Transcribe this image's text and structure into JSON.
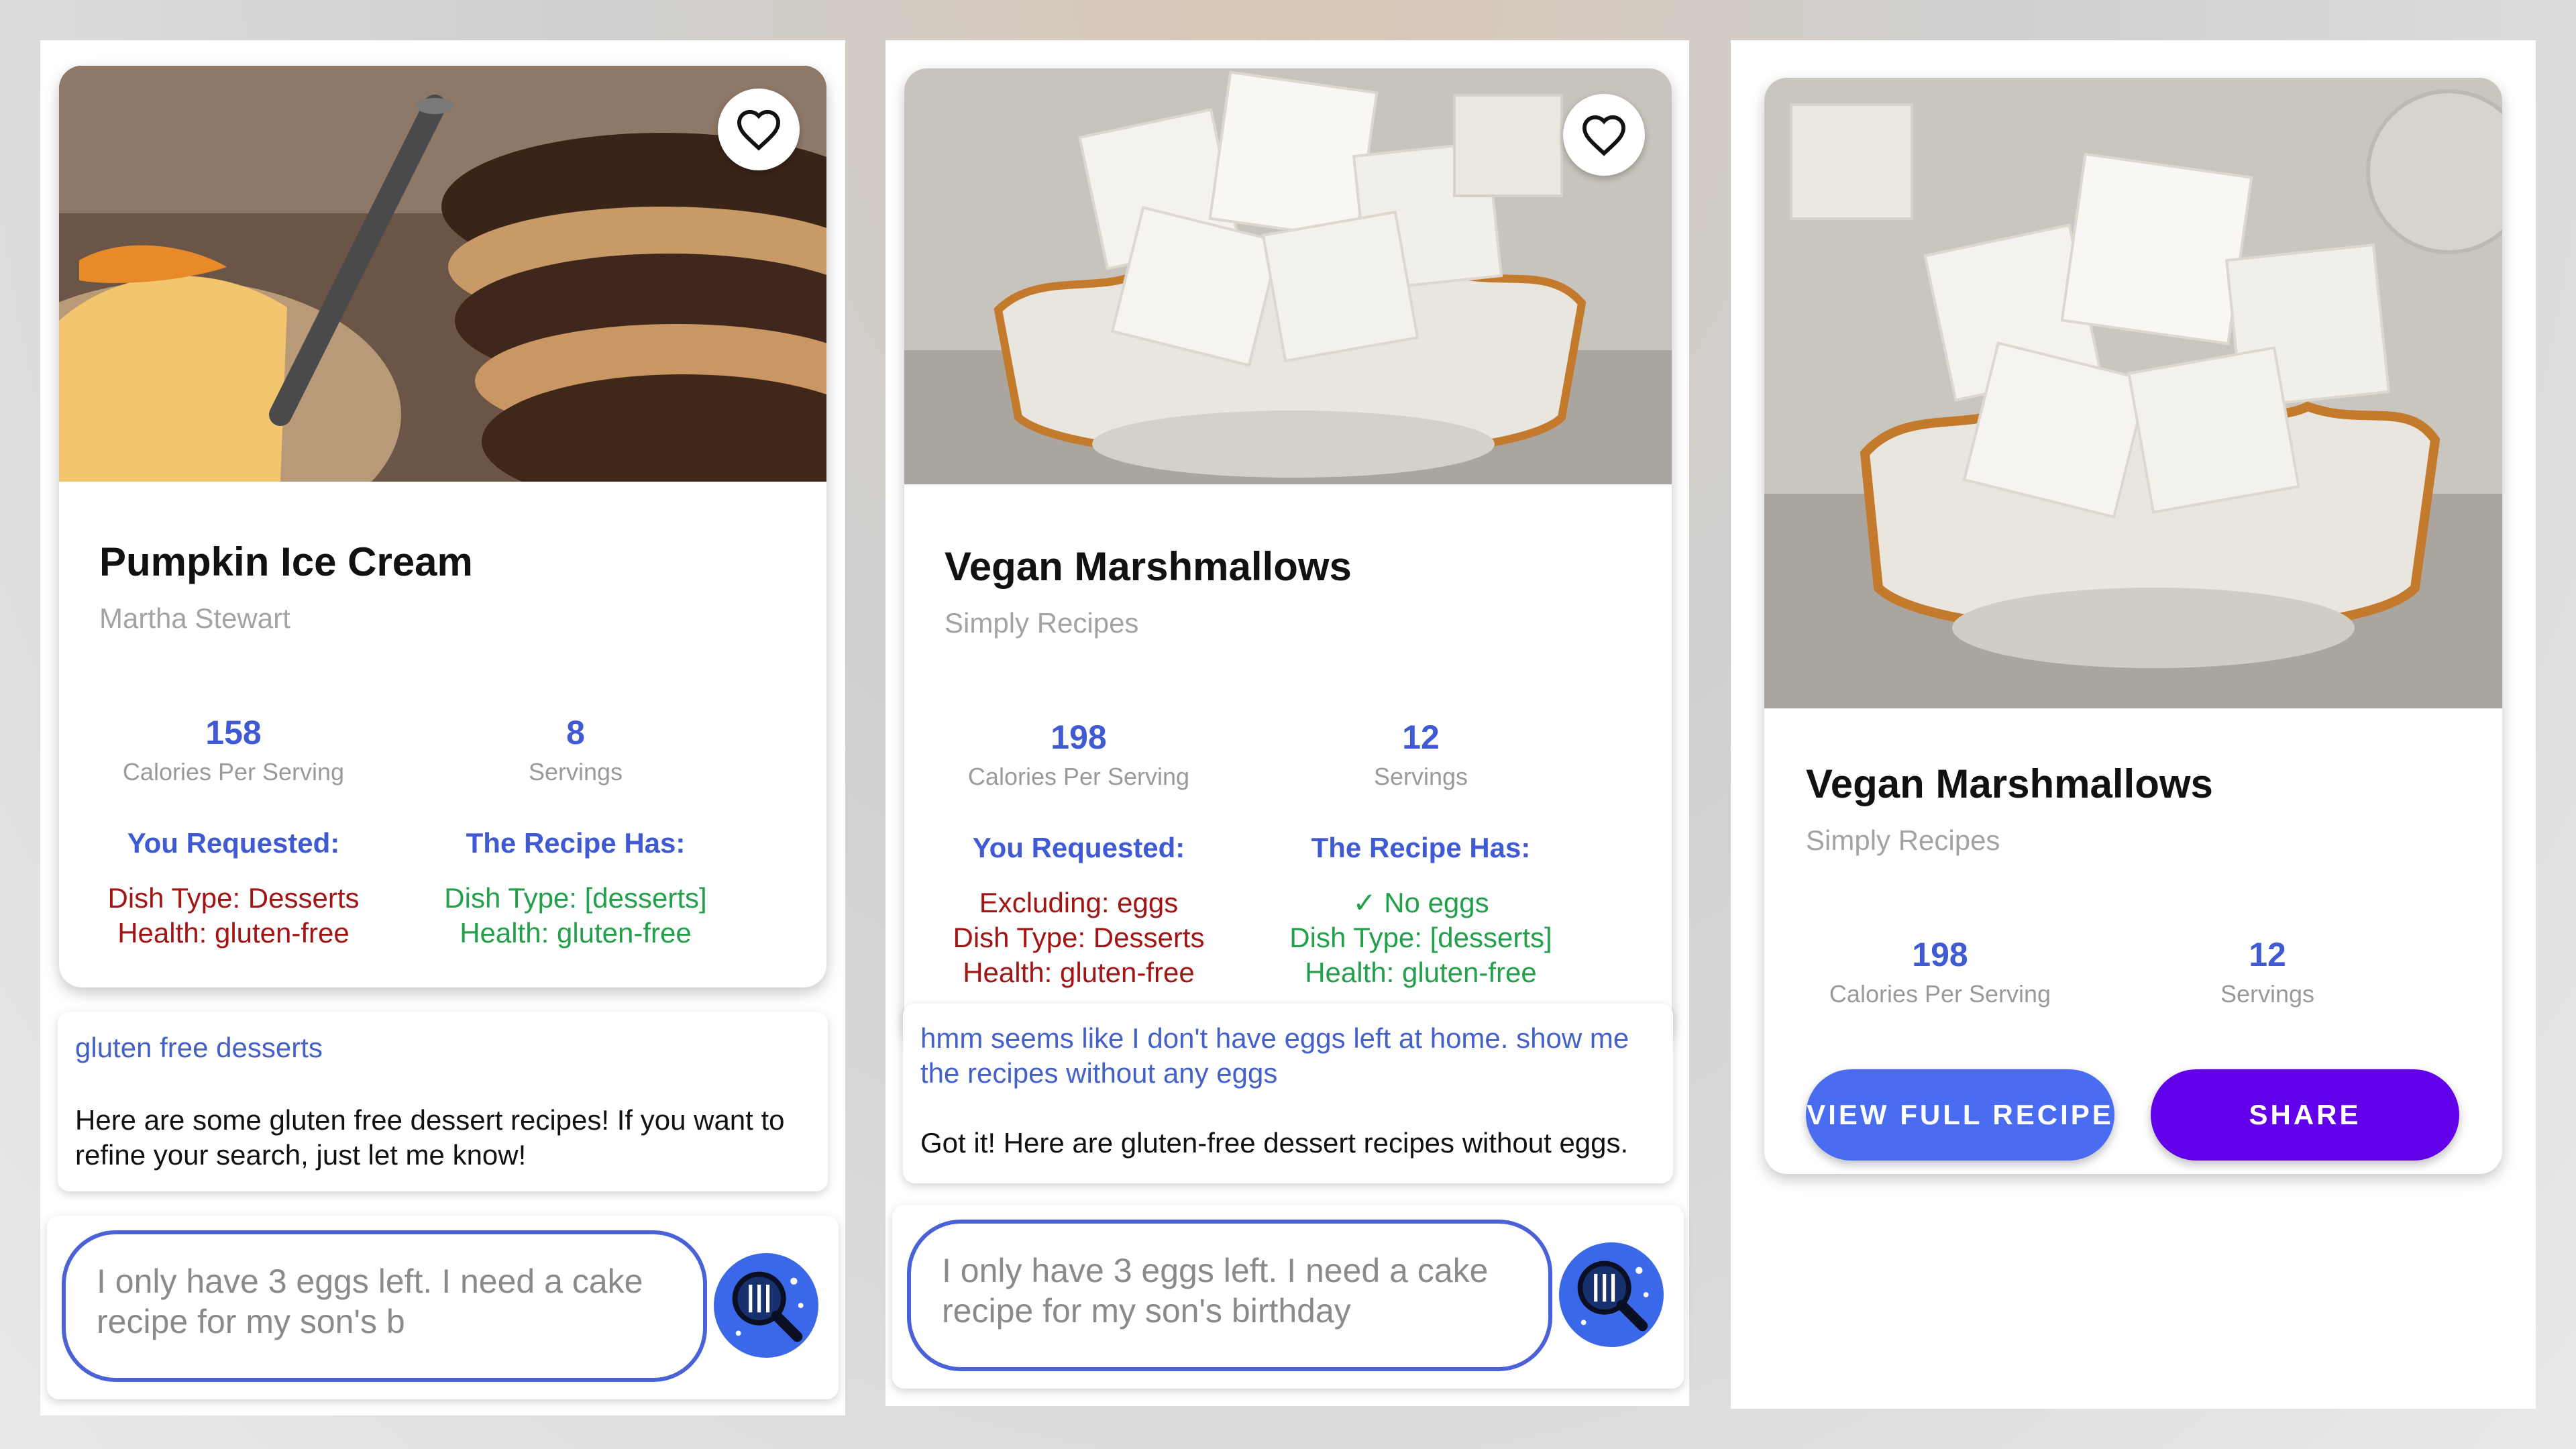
{
  "panels": [
    {
      "title": "Pumpkin Ice Cream",
      "source": "Martha Stewart",
      "calories": "158",
      "calories_label": "Calories Per Serving",
      "servings": "8",
      "servings_label": "Servings",
      "requested_heading": "You Requested:",
      "has_heading": "The Recipe Has:",
      "requested": [
        "Dish Type: Desserts",
        "Health: gluten-free"
      ],
      "has": [
        "Dish Type: [desserts]",
        "Health: gluten-free"
      ],
      "user_message": "gluten free desserts",
      "bot_message": "Here are some gluten free dessert recipes! If you want to refine your search, just let me know!",
      "input_value": "I only have 3 eggs left. I need a cake recipe for my son's b"
    },
    {
      "title": "Vegan Marshmallows",
      "source": "Simply Recipes",
      "calories": "198",
      "calories_label": "Calories Per Serving",
      "servings": "12",
      "servings_label": "Servings",
      "requested_heading": "You Requested:",
      "has_heading": "The Recipe Has:",
      "requested": [
        "Excluding: eggs",
        "Dish Type: Desserts",
        "Health: gluten-free"
      ],
      "has": [
        "✓ No eggs",
        "Dish Type: [desserts]",
        "Health: gluten-free"
      ],
      "user_message": "hmm seems like I don't have eggs left at home. show me the recipes without any eggs",
      "bot_message": "Got it! Here are gluten-free dessert recipes without eggs.",
      "input_value": "I only have 3 eggs left. I need a cake recipe for my son's birthday"
    },
    {
      "title": "Vegan Marshmallows",
      "source": "Simply Recipes",
      "calories": "198",
      "calories_label": "Calories Per Serving",
      "servings": "12",
      "servings_label": "Servings",
      "view_button": "VIEW FULL RECIPE",
      "share_button": "SHARE"
    }
  ],
  "icons": {
    "favorite": "heart-outline-icon",
    "search": "recipe-search-icon"
  },
  "colors": {
    "accent_blue": "#3f5ad3",
    "requested_red": "#a31515",
    "has_green": "#22a04a",
    "view_button": "#4a6cf0",
    "share_button": "#6200ea"
  }
}
